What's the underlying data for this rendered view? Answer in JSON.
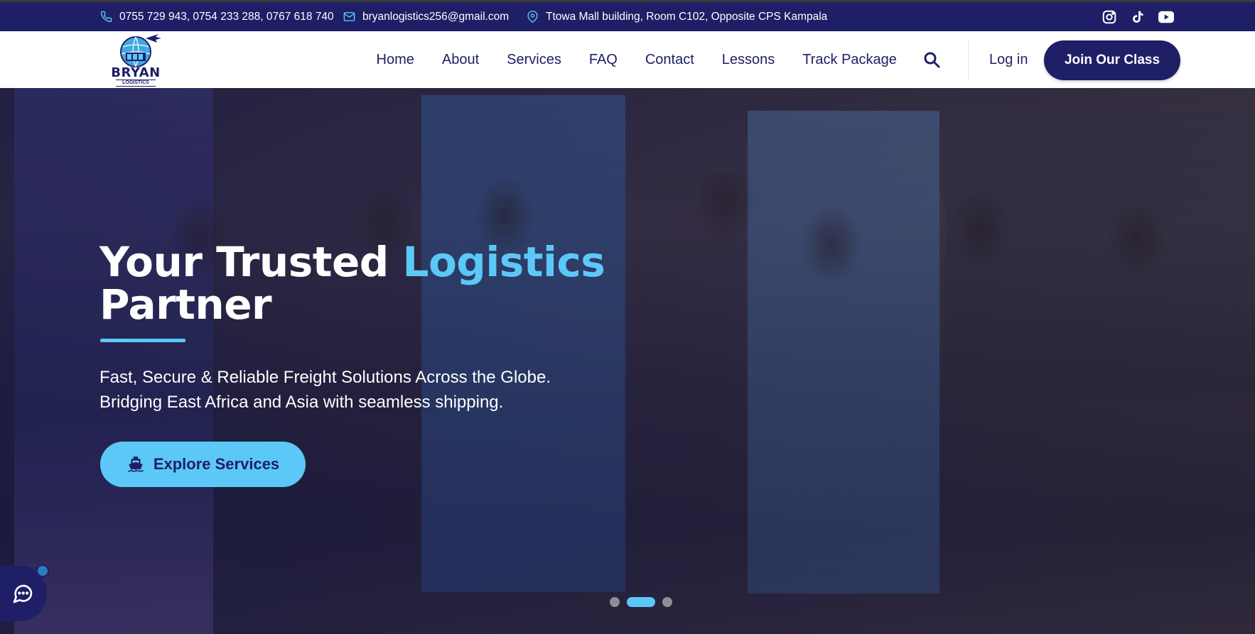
{
  "topbar": {
    "phones": "0755 729 943, 0754 233 288, 0767 618 740",
    "email": "bryanlogistics256@gmail.com",
    "address": "Ttowa Mall building, Room C102, Opposite CPS Kampala",
    "socials": [
      "instagram-icon",
      "tiktok-icon",
      "youtube-icon"
    ]
  },
  "logo": {
    "name": "BRYAN",
    "sub": "LOGISTICS"
  },
  "nav": {
    "links": [
      "Home",
      "About",
      "Services",
      "FAQ",
      "Contact",
      "Lessons",
      "Track Package"
    ],
    "login": "Log in",
    "join": "Join Our Class"
  },
  "hero": {
    "title_part1": "Your Trusted ",
    "title_accent": "Logistics",
    "title_part2": "Partner",
    "subtitle_line1": "Fast, Secure & Reliable Freight Solutions Across the Globe.",
    "subtitle_line2": "Bridging East Africa and Asia with seamless shipping.",
    "cta": "Explore Services",
    "slides": 3,
    "active_slide": 2
  },
  "colors": {
    "brand_navy": "#1e1f66",
    "accent_blue": "#5cc8f7",
    "white": "#ffffff"
  }
}
